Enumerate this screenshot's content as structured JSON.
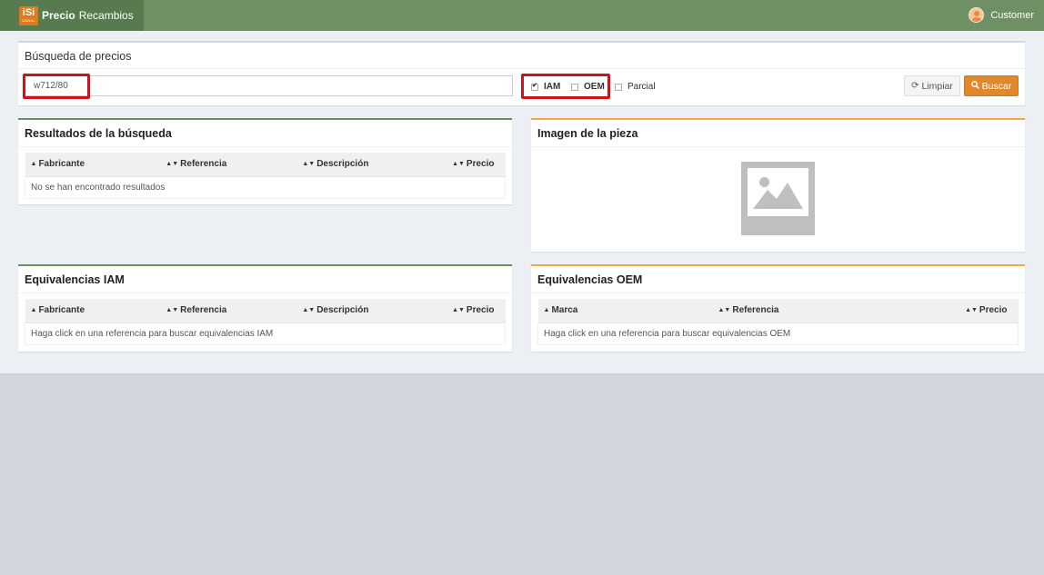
{
  "header": {
    "logo_top": "iSi",
    "logo_bottom": "CANAL",
    "app_bold": "Precio",
    "app_rest": "Recambios",
    "user_label": "Customer"
  },
  "search": {
    "title": "Búsqueda de precios",
    "input_value": "w712/80",
    "checkboxes": [
      {
        "label": "IAM",
        "checked": true
      },
      {
        "label": "OEM",
        "checked": false
      },
      {
        "label": "Parcial",
        "checked": false
      }
    ],
    "clear_label": "Limpiar",
    "search_label": "Buscar"
  },
  "results": {
    "title": "Resultados de la búsqueda",
    "columns": [
      "Fabricante",
      "Referencia",
      "Descripción",
      "Precio"
    ],
    "empty_text": "No se han encontrado resultados"
  },
  "image": {
    "title": "Imagen de la pieza"
  },
  "iam": {
    "title": "Equivalencias IAM",
    "columns": [
      "Fabricante",
      "Referencia",
      "Descripción",
      "Precio"
    ],
    "empty_text": "Haga click en una referencia para buscar equivalencias IAM"
  },
  "oem": {
    "title": "Equivalencias OEM",
    "columns": [
      "Marca",
      "Referencia",
      "Precio"
    ],
    "empty_text": "Haga click en una referencia para buscar equivalencias OEM"
  },
  "colors": {
    "header_bg": "#6f8f65",
    "brand_bg": "#577a4e",
    "accent_orange": "#e0882c",
    "highlight_red": "#c9151b"
  }
}
